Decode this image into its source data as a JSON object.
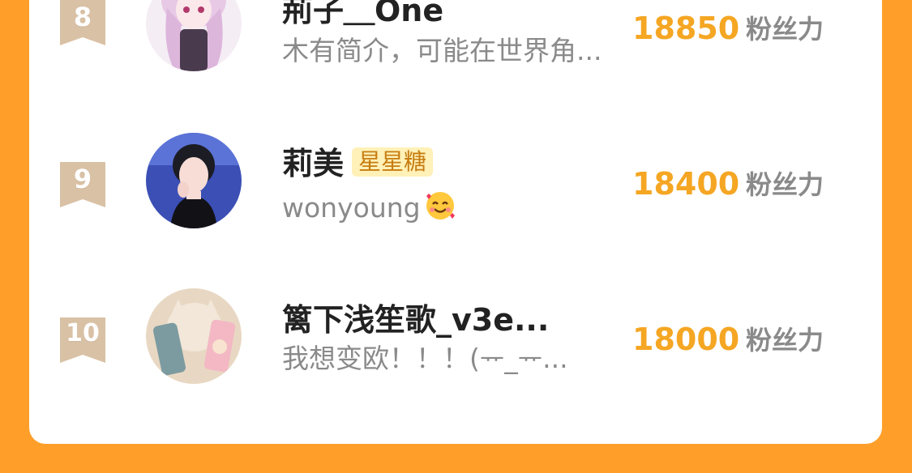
{
  "colors": {
    "background": "#FF9F2A",
    "card": "#ffffff",
    "score": "#F5A623",
    "rank_ribbon": "#D9C1A5",
    "badge_bg": "#FFF1B8",
    "badge_text": "#C77D10"
  },
  "leaderboard": {
    "entries": [
      {
        "rank": "8",
        "name": "荊子＿One",
        "bio": "木有简介，可能在世界角...",
        "score": "18850",
        "unit": "粉丝力",
        "avatar_icon": "anime-girl-avatar"
      },
      {
        "rank": "9",
        "name": "莉美",
        "badge": "星星糖",
        "bio": "wonyoung",
        "bio_emoji": "smiling-face-with-hearts",
        "score": "18400",
        "unit": "粉丝力",
        "avatar_icon": "girl-photo-avatar"
      },
      {
        "rank": "10",
        "name": "篱下浅笙歌_v3e...",
        "bio": "我想变欧！！！(ᅲ_ᅲ...",
        "score": "18000",
        "unit": "粉丝力",
        "avatar_icon": "phone-cases-avatar"
      }
    ]
  }
}
